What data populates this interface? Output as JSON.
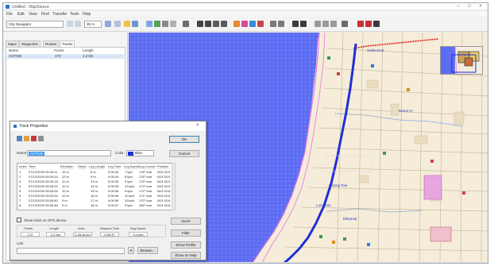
{
  "window": {
    "title": "Untitled - MapSource",
    "controls": [
      "–",
      "□",
      "×"
    ]
  },
  "menu": [
    "File",
    "Edit",
    "View",
    "Find",
    "Transfer",
    "Tools",
    "Help"
  ],
  "toolbar": {
    "map_product": "City Navigator",
    "zoom_select": "30 m"
  },
  "left_panel": {
    "tabs": [
      "Maps",
      "Waypoints",
      "Routes",
      "Tracks"
    ],
    "active_tab": 3,
    "columns": [
      "Name",
      "Points",
      "Length"
    ],
    "row": {
      "name": "ACTIVE",
      "points": "172",
      "length": "4.2 km"
    }
  },
  "map": {
    "labels": [
      "Sukhumvit",
      "Rama IV",
      "Khlong Toei",
      "Lumphini",
      "Ekkamai"
    ]
  },
  "dialog": {
    "title": "Track Properties",
    "ok": "OK",
    "cancel": "Cancel",
    "name_label": "Name:",
    "name_value": "ACTIVE",
    "color_label": "Color:",
    "color_value": "Blue",
    "columns": [
      "Index",
      "Time",
      "Elevation",
      "Depth",
      "Leg Length",
      "Leg Time",
      "Leg Speed",
      "Leg Course",
      "Position"
    ],
    "rows": [
      [
        "1",
        "07/12/2020 05:03:11",
        "12 m",
        "",
        "6 m",
        "0:00:03",
        "7 kph",
        "178° true",
        "N13 43.9"
      ],
      [
        "2",
        "07/12/2020 05:03:14",
        "12 m",
        "",
        "9 m",
        "0:00:04",
        "8 kph",
        "176° true",
        "N13 43.9"
      ],
      [
        "3",
        "07/12/2020 05:03:18",
        "11 m",
        "",
        "13 m",
        "0:00:05",
        "9 kph",
        "175° true",
        "N13 43.9"
      ],
      [
        "4",
        "07/12/2020 05:03:23",
        "11 m",
        "",
        "14 m",
        "0:00:05",
        "10 kph",
        "173° true",
        "N13 43.9"
      ],
      [
        "5",
        "07/12/2020 05:03:28",
        "10 m",
        "",
        "15 m",
        "0:00:06",
        "9 kph",
        "172° true",
        "N13 43.8"
      ],
      [
        "6",
        "07/12/2020 05:03:34",
        "10 m",
        "",
        "16 m",
        "0:00:06",
        "10 kph",
        "171° true",
        "N13 43.8"
      ],
      [
        "7",
        "07/12/2020 05:03:40",
        "9 m",
        "",
        "17 m",
        "0:00:06",
        "10 kph",
        "170° true",
        "N13 43.8"
      ],
      [
        "8",
        "07/12/2020 05:03:46",
        "9 m",
        "",
        "18 m",
        "0:00:07",
        "9 kph",
        "169° true",
        "N13 43.8"
      ]
    ],
    "checkbox_label": "Show track on GPS device",
    "stats_headers": [
      "Points",
      "Length",
      "Area",
      "Elapsed Time",
      "Avg Speed"
    ],
    "stats_values": [
      "172",
      "4.2 km",
      "0.28 sq km",
      "0:26:47",
      "9.4 kph"
    ],
    "link_label": "Link",
    "buttons": {
      "invert": "Invert",
      "filter": "Filter",
      "show_profile": "Show Profile",
      "show_on_map": "Show on Map",
      "browse": "Browse..."
    }
  },
  "colors": {
    "water": "#5d6df2",
    "track": "#1f2fd6",
    "route_red": "#e02020",
    "road_pink": "#e877d8",
    "dialog_swatch": "#1f2fd6"
  }
}
